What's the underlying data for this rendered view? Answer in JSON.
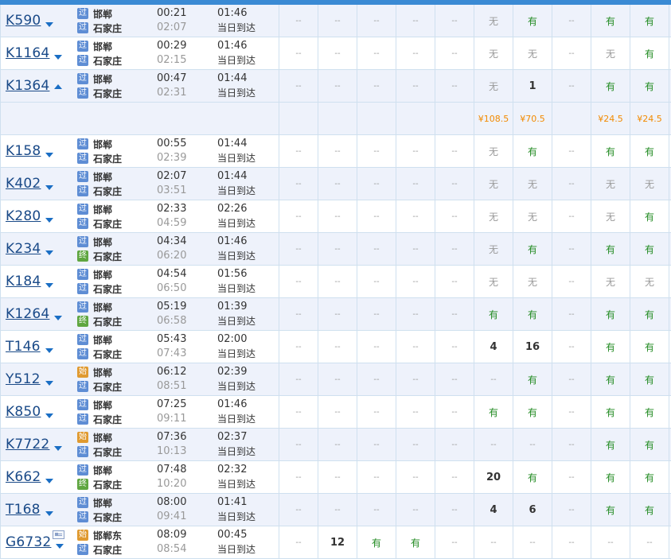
{
  "trains": [
    {
      "code": "K590",
      "arrow": "down",
      "card": false,
      "from": {
        "badge": "过",
        "badge_type": "pass",
        "name": "邯郸"
      },
      "to": {
        "badge": "过",
        "badge_type": "pass",
        "name": "石家庄"
      },
      "depart": "00:21",
      "arrive": "02:07",
      "duration": "01:46",
      "arrival_note": "当日到达",
      "seats": [
        "--",
        "--",
        "--",
        "--",
        "--",
        "无",
        "有",
        "--",
        "有",
        "有"
      ]
    },
    {
      "code": "K1164",
      "arrow": "down",
      "card": false,
      "from": {
        "badge": "过",
        "badge_type": "pass",
        "name": "邯郸"
      },
      "to": {
        "badge": "过",
        "badge_type": "pass",
        "name": "石家庄"
      },
      "depart": "00:29",
      "arrive": "02:15",
      "duration": "01:46",
      "arrival_note": "当日到达",
      "seats": [
        "--",
        "--",
        "--",
        "--",
        "--",
        "无",
        "无",
        "--",
        "无",
        "有"
      ]
    },
    {
      "code": "K1364",
      "arrow": "up",
      "card": false,
      "from": {
        "badge": "过",
        "badge_type": "pass",
        "name": "邯郸"
      },
      "to": {
        "badge": "过",
        "badge_type": "pass",
        "name": "石家庄"
      },
      "depart": "00:47",
      "arrive": "02:31",
      "duration": "01:44",
      "arrival_note": "当日到达",
      "seats": [
        "--",
        "--",
        "--",
        "--",
        "--",
        "无",
        "1",
        "--",
        "有",
        "有"
      ]
    },
    {
      "price_row": true,
      "seats": [
        "",
        "",
        "",
        "",
        "",
        "¥108.5",
        "¥70.5",
        "",
        "¥24.5",
        "¥24.5"
      ]
    },
    {
      "code": "K158",
      "arrow": "down",
      "card": false,
      "from": {
        "badge": "过",
        "badge_type": "pass",
        "name": "邯郸"
      },
      "to": {
        "badge": "过",
        "badge_type": "pass",
        "name": "石家庄"
      },
      "depart": "00:55",
      "arrive": "02:39",
      "duration": "01:44",
      "arrival_note": "当日到达",
      "seats": [
        "--",
        "--",
        "--",
        "--",
        "--",
        "无",
        "有",
        "--",
        "有",
        "有"
      ]
    },
    {
      "code": "K402",
      "arrow": "down",
      "card": false,
      "from": {
        "badge": "过",
        "badge_type": "pass",
        "name": "邯郸"
      },
      "to": {
        "badge": "过",
        "badge_type": "pass",
        "name": "石家庄"
      },
      "depart": "02:07",
      "arrive": "03:51",
      "duration": "01:44",
      "arrival_note": "当日到达",
      "seats": [
        "--",
        "--",
        "--",
        "--",
        "--",
        "无",
        "无",
        "--",
        "无",
        "无"
      ]
    },
    {
      "code": "K280",
      "arrow": "down",
      "card": false,
      "from": {
        "badge": "过",
        "badge_type": "pass",
        "name": "邯郸"
      },
      "to": {
        "badge": "过",
        "badge_type": "pass",
        "name": "石家庄"
      },
      "depart": "02:33",
      "arrive": "04:59",
      "duration": "02:26",
      "arrival_note": "当日到达",
      "seats": [
        "--",
        "--",
        "--",
        "--",
        "--",
        "无",
        "无",
        "--",
        "无",
        "有"
      ]
    },
    {
      "code": "K234",
      "arrow": "down",
      "card": false,
      "from": {
        "badge": "过",
        "badge_type": "pass",
        "name": "邯郸"
      },
      "to": {
        "badge": "终",
        "badge_type": "end",
        "name": "石家庄"
      },
      "depart": "04:34",
      "arrive": "06:20",
      "duration": "01:46",
      "arrival_note": "当日到达",
      "seats": [
        "--",
        "--",
        "--",
        "--",
        "--",
        "无",
        "有",
        "--",
        "有",
        "有"
      ]
    },
    {
      "code": "K184",
      "arrow": "down",
      "card": false,
      "from": {
        "badge": "过",
        "badge_type": "pass",
        "name": "邯郸"
      },
      "to": {
        "badge": "过",
        "badge_type": "pass",
        "name": "石家庄"
      },
      "depart": "04:54",
      "arrive": "06:50",
      "duration": "01:56",
      "arrival_note": "当日到达",
      "seats": [
        "--",
        "--",
        "--",
        "--",
        "--",
        "无",
        "无",
        "--",
        "无",
        "无"
      ]
    },
    {
      "code": "K1264",
      "arrow": "down",
      "card": false,
      "from": {
        "badge": "过",
        "badge_type": "pass",
        "name": "邯郸"
      },
      "to": {
        "badge": "终",
        "badge_type": "end",
        "name": "石家庄"
      },
      "depart": "05:19",
      "arrive": "06:58",
      "duration": "01:39",
      "arrival_note": "当日到达",
      "seats": [
        "--",
        "--",
        "--",
        "--",
        "--",
        "有",
        "有",
        "--",
        "有",
        "有"
      ]
    },
    {
      "code": "T146",
      "arrow": "down",
      "card": false,
      "from": {
        "badge": "过",
        "badge_type": "pass",
        "name": "邯郸"
      },
      "to": {
        "badge": "过",
        "badge_type": "pass",
        "name": "石家庄"
      },
      "depart": "05:43",
      "arrive": "07:43",
      "duration": "02:00",
      "arrival_note": "当日到达",
      "seats": [
        "--",
        "--",
        "--",
        "--",
        "--",
        "4",
        "16",
        "--",
        "有",
        "有"
      ]
    },
    {
      "code": "Y512",
      "arrow": "down",
      "card": false,
      "from": {
        "badge": "始",
        "badge_type": "start",
        "name": "邯郸"
      },
      "to": {
        "badge": "过",
        "badge_type": "pass",
        "name": "石家庄"
      },
      "depart": "06:12",
      "arrive": "08:51",
      "duration": "02:39",
      "arrival_note": "当日到达",
      "seats": [
        "--",
        "--",
        "--",
        "--",
        "--",
        "--",
        "有",
        "--",
        "有",
        "有"
      ]
    },
    {
      "code": "K850",
      "arrow": "down",
      "card": false,
      "from": {
        "badge": "过",
        "badge_type": "pass",
        "name": "邯郸"
      },
      "to": {
        "badge": "过",
        "badge_type": "pass",
        "name": "石家庄"
      },
      "depart": "07:25",
      "arrive": "09:11",
      "duration": "01:46",
      "arrival_note": "当日到达",
      "seats": [
        "--",
        "--",
        "--",
        "--",
        "--",
        "有",
        "有",
        "--",
        "有",
        "有"
      ]
    },
    {
      "code": "K7722",
      "arrow": "down",
      "card": false,
      "from": {
        "badge": "始",
        "badge_type": "start",
        "name": "邯郸"
      },
      "to": {
        "badge": "过",
        "badge_type": "pass",
        "name": "石家庄"
      },
      "depart": "07:36",
      "arrive": "10:13",
      "duration": "02:37",
      "arrival_note": "当日到达",
      "seats": [
        "--",
        "--",
        "--",
        "--",
        "--",
        "--",
        "--",
        "--",
        "有",
        "有"
      ]
    },
    {
      "code": "K662",
      "arrow": "down",
      "card": false,
      "from": {
        "badge": "过",
        "badge_type": "pass",
        "name": "邯郸"
      },
      "to": {
        "badge": "终",
        "badge_type": "end",
        "name": "石家庄"
      },
      "depart": "07:48",
      "arrive": "10:20",
      "duration": "02:32",
      "arrival_note": "当日到达",
      "seats": [
        "--",
        "--",
        "--",
        "--",
        "--",
        "20",
        "有",
        "--",
        "有",
        "有"
      ]
    },
    {
      "code": "T168",
      "arrow": "down",
      "card": false,
      "from": {
        "badge": "过",
        "badge_type": "pass",
        "name": "邯郸"
      },
      "to": {
        "badge": "过",
        "badge_type": "pass",
        "name": "石家庄"
      },
      "depart": "08:00",
      "arrive": "09:41",
      "duration": "01:41",
      "arrival_note": "当日到达",
      "seats": [
        "--",
        "--",
        "--",
        "--",
        "--",
        "4",
        "6",
        "--",
        "有",
        "有"
      ]
    },
    {
      "code": "G6732",
      "arrow": "down",
      "card": true,
      "from": {
        "badge": "始",
        "badge_type": "start",
        "name": "邯郸东"
      },
      "to": {
        "badge": "过",
        "badge_type": "pass",
        "name": "石家庄"
      },
      "depart": "08:09",
      "arrive": "08:54",
      "duration": "00:45",
      "arrival_note": "当日到达",
      "seats": [
        "--",
        "12",
        "有",
        "有",
        "--",
        "--",
        "--",
        "--",
        "--",
        "--"
      ]
    }
  ]
}
